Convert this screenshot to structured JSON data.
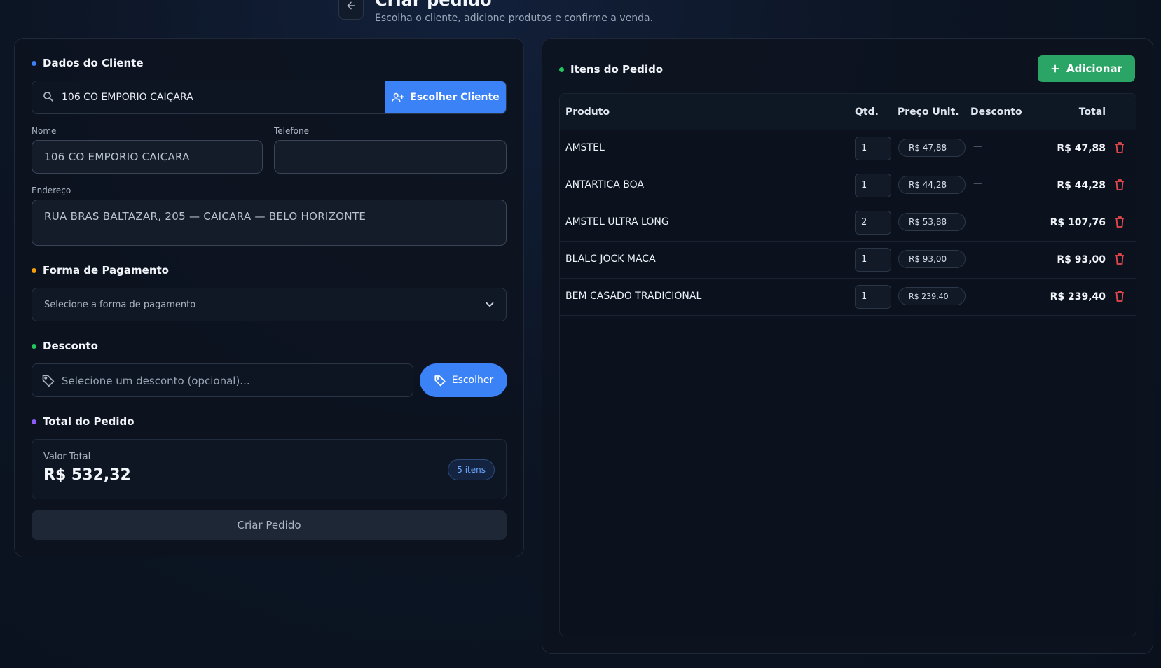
{
  "header": {
    "title": "Criar pedido",
    "subtitle": "Escolha o cliente, adicione produtos e confirme a venda."
  },
  "colors": {
    "accent_blue": "#3b82f6",
    "accent_green": "#2aa566",
    "danger_red": "#e5484d",
    "dot_blue": "#3b82f6",
    "dot_orange": "#f59e0b",
    "dot_green": "#22c55e",
    "dot_purple": "#8b5cf6"
  },
  "client": {
    "section_title": "Dados do Cliente",
    "search_value": "106 CO EMPORIO CAIÇARA",
    "choose_button": "Escolher Cliente",
    "name_label": "Nome",
    "name_value": "106 CO EMPORIO CAIÇARA",
    "phone_label": "Telefone",
    "phone_value": "",
    "address_label": "Endereço",
    "address_value": "RUA BRAS BALTAZAR, 205 — CAICARA — BELO HORIZONTE"
  },
  "payment": {
    "section_title": "Forma de Pagamento",
    "placeholder": "Selecione a forma de pagamento"
  },
  "discount": {
    "section_title": "Desconto",
    "placeholder": "Selecione um desconto (opcional)...",
    "choose_button": "Escolher"
  },
  "summary": {
    "section_title": "Total do Pedido",
    "total_label": "Valor Total",
    "total_value": "R$ 532,32",
    "items_badge": "5 itens",
    "create_button": "Criar Pedido"
  },
  "items": {
    "section_title": "Itens do Pedido",
    "add_button": "Adicionar",
    "columns": [
      "Produto",
      "Qtd.",
      "Preço Unit.",
      "Desconto",
      "Total"
    ],
    "rows": [
      {
        "product": "AMSTEL",
        "qty": "1",
        "unit_price": "R$ 47,88",
        "discount": "—",
        "total": "R$ 47,88"
      },
      {
        "product": "ANTARTICA BOA",
        "qty": "1",
        "unit_price": "R$ 44,28",
        "discount": "—",
        "total": "R$ 44,28"
      },
      {
        "product": "AMSTEL ULTRA LONG",
        "qty": "2",
        "unit_price": "R$ 53,88",
        "discount": "—",
        "total": "R$ 107,76"
      },
      {
        "product": "BLALC JOCK MACA",
        "qty": "1",
        "unit_price": "R$ 93,00",
        "discount": "—",
        "total": "R$ 93,00"
      },
      {
        "product": "BEM CASADO TRADICIONAL",
        "qty": "1",
        "unit_price": "R$ 239,40",
        "discount": "—",
        "total": "R$ 239,40"
      }
    ]
  },
  "icons": {
    "back": "arrow-left-icon",
    "search": "search-icon",
    "user_plus": "user-plus-icon",
    "chevron": "chevron-down-icon",
    "tag": "tag-icon",
    "plus": "plus-icon",
    "trash": "trash-icon"
  }
}
